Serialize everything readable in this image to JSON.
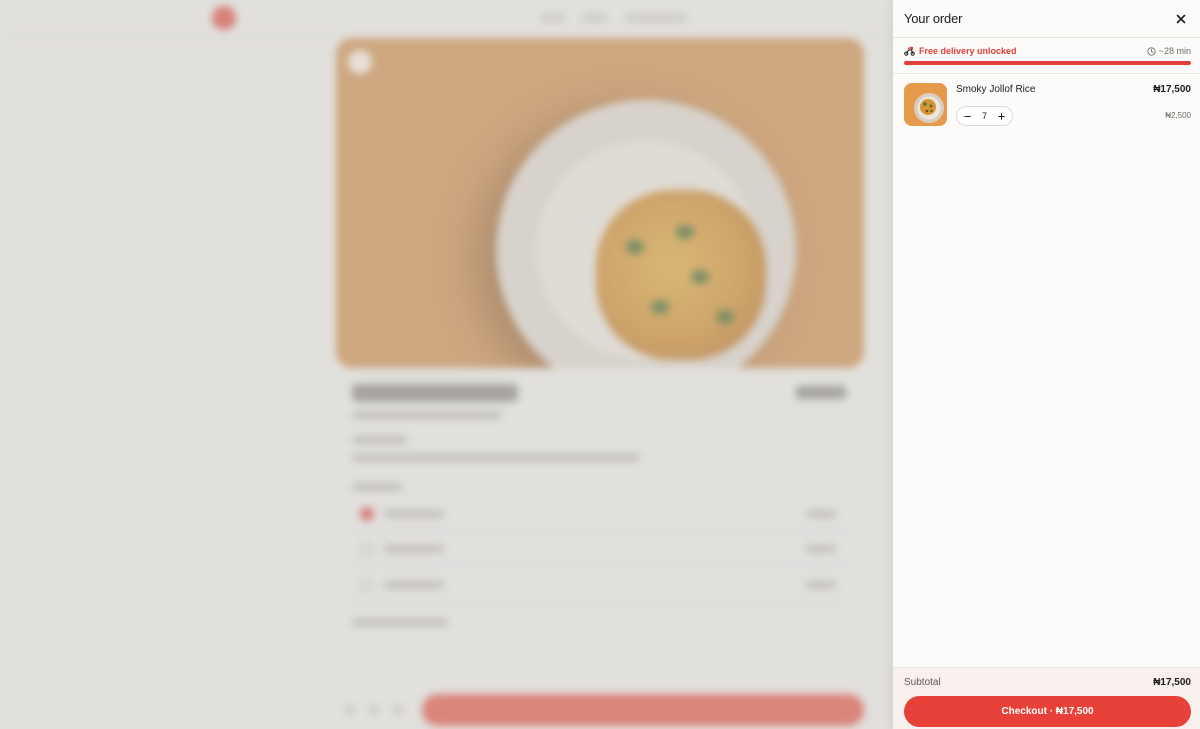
{
  "background_page": {
    "title_hint": "",
    "blurred": true
  },
  "cart": {
    "title": "Your order",
    "close_icon": "close-icon",
    "delivery": {
      "status": "Free delivery unlocked",
      "status_icon": "scooter-icon",
      "eta": "~28 min",
      "eta_icon": "clock-icon",
      "progress_fraction": 1.0
    },
    "items": [
      {
        "name": "Smoky Jollof Rice",
        "total": "₦17,500",
        "unit_price": "₦2,500",
        "quantity": "7",
        "decrement_icon": "minus-icon",
        "increment_icon": "plus-icon",
        "thumbnail": "jollof-rice-thumbnail"
      }
    ],
    "subtotal_label": "Subtotal",
    "subtotal_value": "₦17,500",
    "checkout_label": "Checkout · ₦17,500"
  },
  "colors": {
    "accent": "#e8413a",
    "progress": "#e0403a",
    "drawer_bg": "#fcfbfa",
    "footer_bg": "#f7f0ec"
  }
}
